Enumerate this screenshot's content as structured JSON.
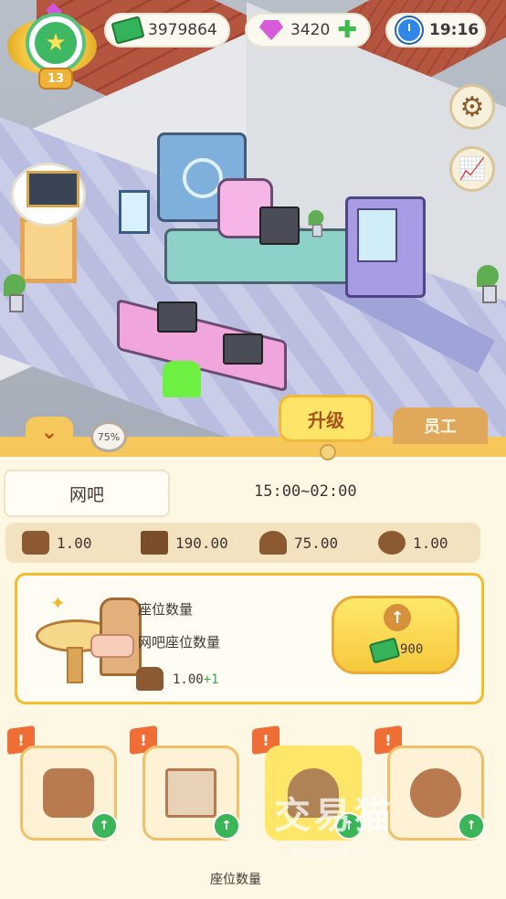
{
  "hud": {
    "level": "13",
    "cash": "3979864",
    "gems": "3420",
    "time": "19:16"
  },
  "icons": {
    "level": "star-icon",
    "cash": "cash-icon",
    "gems": "gem-icon",
    "add_gems": "plus-icon",
    "clock": "clock-icon",
    "settings": "gear-icon",
    "stats": "chart-icon",
    "collapse": "chevron-down-icon"
  },
  "colors": {
    "panel_bg": "#fdf7e4",
    "accent_yellow": "#f6c85b",
    "upgrade_border": "#f4bd2c",
    "green": "#3cbc4f"
  },
  "panel": {
    "collapse_symbol": "⌄",
    "progress_badge": "75%",
    "tab_upgrade": "升级",
    "tab_staff": "员工",
    "shop_name": "网吧",
    "hours": "15:00~02:00",
    "stats": [
      {
        "icon": "sofa-icon",
        "value": "1.00"
      },
      {
        "icon": "cash-stack-icon",
        "value": "190.00"
      },
      {
        "icon": "gauge-icon",
        "value": "75.00"
      },
      {
        "icon": "mouse-icon",
        "value": "1.00"
      }
    ],
    "upgrade": {
      "title": "座位数量",
      "desc": "网吧座位数量",
      "current": "1.00",
      "increment": "+1",
      "button_arrow": "↑",
      "price": "900"
    },
    "cards": [
      {
        "icon": "sofa-icon",
        "badge": "!"
      },
      {
        "icon": "cash-stack-icon",
        "badge": "!"
      },
      {
        "icon": "gauge-icon",
        "badge": "!"
      },
      {
        "icon": "mouse-icon",
        "badge": "!"
      }
    ],
    "card_caption": "座位数量",
    "card_up_symbol": "↑"
  },
  "watermark": {
    "text": "交易猫",
    "sub": "jiaoyimao.com"
  }
}
